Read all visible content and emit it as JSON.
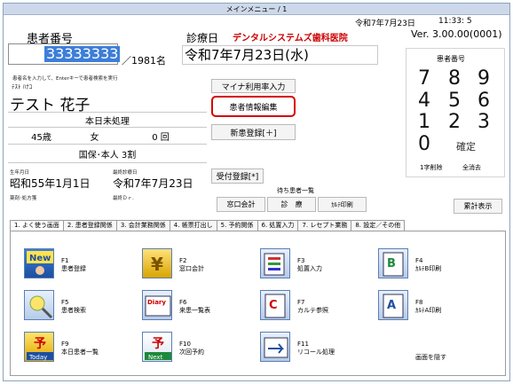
{
  "window": {
    "title": "メインメニュー / 1"
  },
  "header": {
    "date": "令和7年7月23日",
    "time": "11:33: 5",
    "version": "Ver. 3.00.00(0001)"
  },
  "patient": {
    "number_label": "患者番号",
    "number_value": "33333333",
    "total": "／1981名",
    "hint": "患者名を入力して、Enterキーで患者検索を実行",
    "kana": "ﾃｽﾄ ﾊﾅｺ",
    "name": "テスト 花子",
    "status": "本日未処理",
    "age": "45歳",
    "gender": "女",
    "visits": "0 回",
    "insurance": "国保･本人 3割",
    "birth_label": "生年月日",
    "birth": "昭和55年1月1日",
    "last_visit_label": "最終診療日",
    "last_visit": "令和7年7月23日",
    "lab_label": "薬剤･処方箋",
    "doctor_label": "最終Ｄｒ."
  },
  "clinic": {
    "date_label": "診療日",
    "name": "デンタルシステムズ歯科医院",
    "date_value": "令和7年7月23日(水)"
  },
  "actions": {
    "mynumber": "マイナ利用率入力",
    "edit_patient": "患者情報編集",
    "new_patient": "新患登録[＋]",
    "reception": "受付登録[*]",
    "waiting_title": "待ち患者一覧",
    "waiting_counter": "窓口会計",
    "waiting_exam": "診　療",
    "waiting_print": "ｶﾙﾃ印刷",
    "totals": "累計表示"
  },
  "keypad": {
    "title": "患者番号",
    "rows": [
      [
        "7",
        "8",
        "9"
      ],
      [
        "4",
        "5",
        "6"
      ],
      [
        "1",
        "2",
        "3"
      ]
    ],
    "zero": "0",
    "confirm": "確定",
    "delete_one": "1字削除",
    "clear_all": "全消去"
  },
  "tabs": [
    "1. よく使う画面",
    "2. 患者登録関係",
    "3. 会計業務関係",
    "4. 帳票打出し",
    "5. 予約関係",
    "6. 処置入力",
    "7. レセプト業務",
    "8. 設定／その他"
  ],
  "functions": [
    {
      "key": "F1",
      "label": "患者登録",
      "icon": "new-patient-icon"
    },
    {
      "key": "F2",
      "label": "窓口会計",
      "icon": "yen-icon"
    },
    {
      "key": "F3",
      "label": "処置入力",
      "icon": "treatment-input-icon"
    },
    {
      "key": "F4",
      "label": "ｶﾙﾃB印刷",
      "icon": "chart-b-print-icon"
    },
    {
      "key": "F5",
      "label": "患者検索",
      "icon": "patient-search-icon"
    },
    {
      "key": "F6",
      "label": "来患一覧表",
      "icon": "diary-icon"
    },
    {
      "key": "F7",
      "label": "カルテ参照",
      "icon": "chart-view-icon"
    },
    {
      "key": "F8",
      "label": "ｶﾙﾃA印刷",
      "icon": "chart-a-print-icon"
    },
    {
      "key": "F9",
      "label": "本日患者一覧",
      "icon": "today-icon"
    },
    {
      "key": "F10",
      "label": "次回予約",
      "icon": "next-appointment-icon"
    },
    {
      "key": "F11",
      "label": "リコール処理",
      "icon": "recall-icon"
    }
  ],
  "hide_screen": "画面を隠す",
  "colors": {
    "accent_red": "#cc0000",
    "selection_blue": "#3d7ed8",
    "highlight_red": "#d40000"
  }
}
